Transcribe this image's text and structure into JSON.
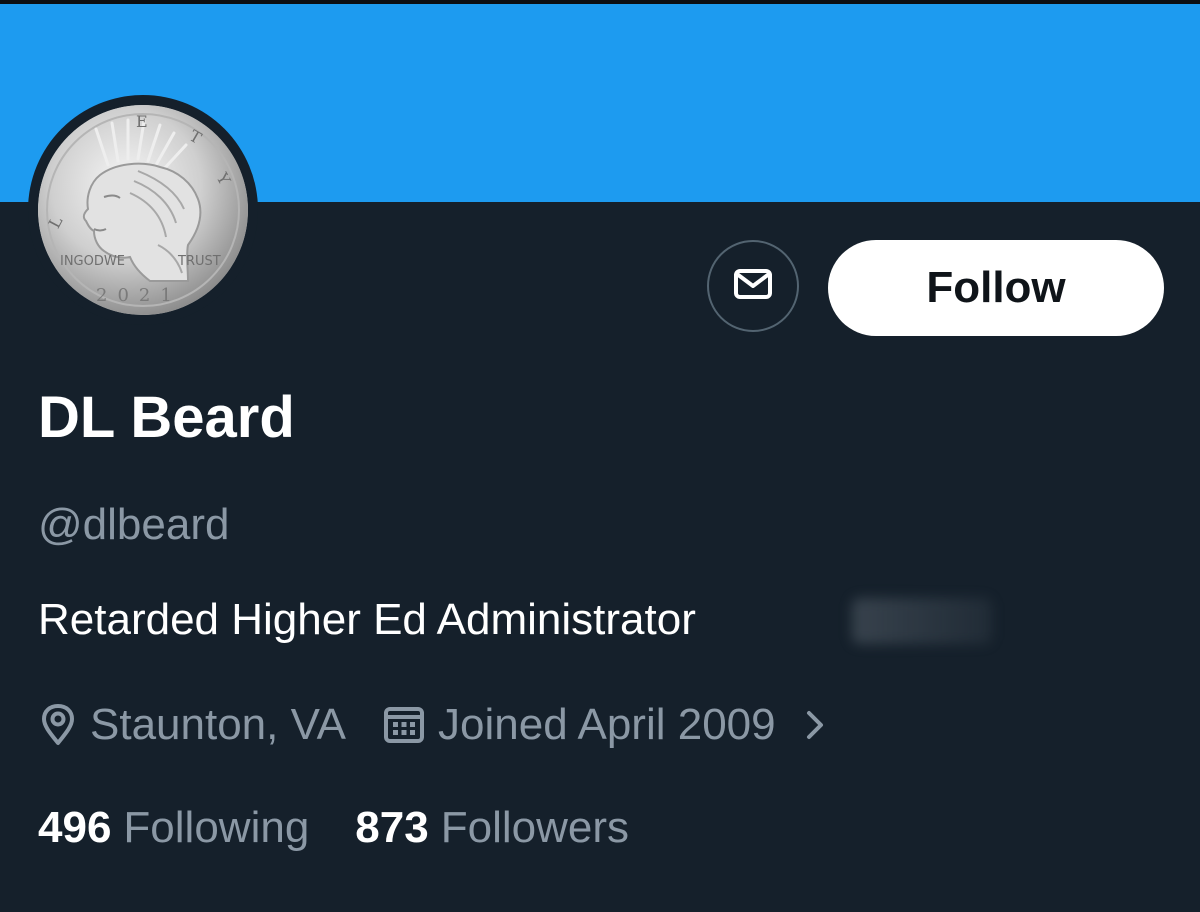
{
  "colors": {
    "banner": "#1d9bf0",
    "background": "#15202b",
    "muted_text": "#8b98a5",
    "primary_text": "#ffffff",
    "follow_button_bg": "#ffffff"
  },
  "profile": {
    "display_name": "DL Beard",
    "handle": "@dlbeard",
    "bio": "Retarded Higher Ed Administrator",
    "location": "Staunton, VA",
    "joined": "Joined April 2009",
    "avatar": {
      "description_icon": "coin-avatar",
      "coin_lettering": {
        "top": "LIBERTY",
        "left": "IN GOD WE",
        "right": "TRUST",
        "bottom": "2021"
      }
    }
  },
  "actions": {
    "message_icon": "envelope-icon",
    "follow_label": "Follow"
  },
  "icons": {
    "location": "location-pin-icon",
    "calendar": "calendar-icon",
    "chevron": "chevron-right-icon"
  },
  "stats": {
    "following_count": "496",
    "following_label": "Following",
    "followers_count": "873",
    "followers_label": "Followers"
  }
}
